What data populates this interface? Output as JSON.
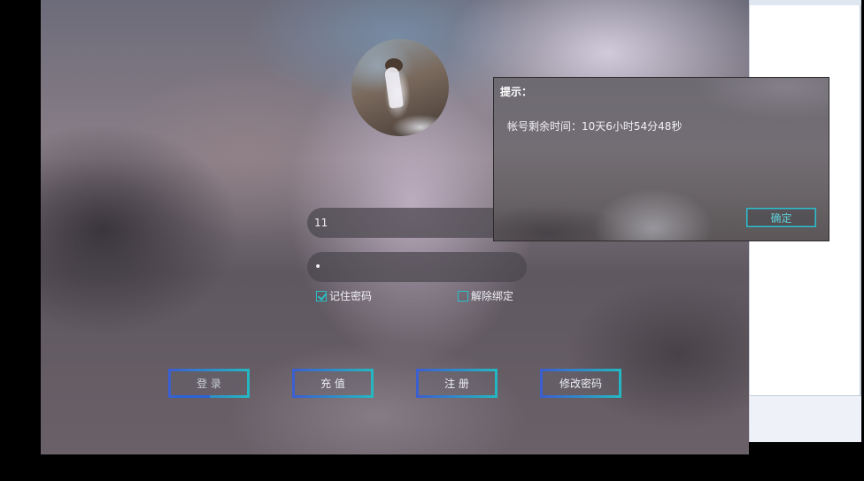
{
  "login": {
    "username_value": "11",
    "password_value": "•",
    "remember_label": "记住密码",
    "remember_checked": true,
    "unbind_label": "解除绑定",
    "unbind_checked": false,
    "buttons": {
      "login": "登 录",
      "recharge": "充 值",
      "register": "注 册",
      "change_password": "修改密码"
    }
  },
  "dialog": {
    "title": "提示：",
    "message": "帐号剩余时间：10天6小时54分48秒",
    "ok_label": "确定"
  },
  "colors": {
    "accent_cyan": "#2bc0c8",
    "accent_blue": "#3b5fd0"
  }
}
